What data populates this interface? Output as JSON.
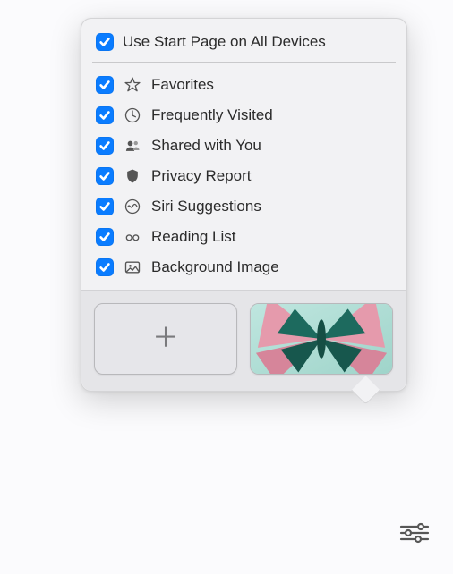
{
  "accentColor": "#0a7cff",
  "header": {
    "label": "Use Start Page on All Devices",
    "checked": true
  },
  "sections": [
    {
      "id": "favorites",
      "label": "Favorites",
      "checked": true,
      "icon": "star-icon"
    },
    {
      "id": "frequently-visited",
      "label": "Frequently Visited",
      "checked": true,
      "icon": "clock-icon"
    },
    {
      "id": "shared-with-you",
      "label": "Shared with You",
      "checked": true,
      "icon": "people-icon"
    },
    {
      "id": "privacy-report",
      "label": "Privacy Report",
      "checked": true,
      "icon": "shield-icon"
    },
    {
      "id": "siri-suggestions",
      "label": "Siri Suggestions",
      "checked": true,
      "icon": "siri-icon"
    },
    {
      "id": "reading-list",
      "label": "Reading List",
      "checked": true,
      "icon": "glasses-icon"
    },
    {
      "id": "background-image",
      "label": "Background Image",
      "checked": true,
      "icon": "image-icon"
    }
  ],
  "thumbnails": {
    "addGlyph": "＋",
    "wallpaper": {
      "name": "butterfly-pink-teal"
    }
  },
  "filtersButton": {
    "name": "customize-start-page"
  }
}
